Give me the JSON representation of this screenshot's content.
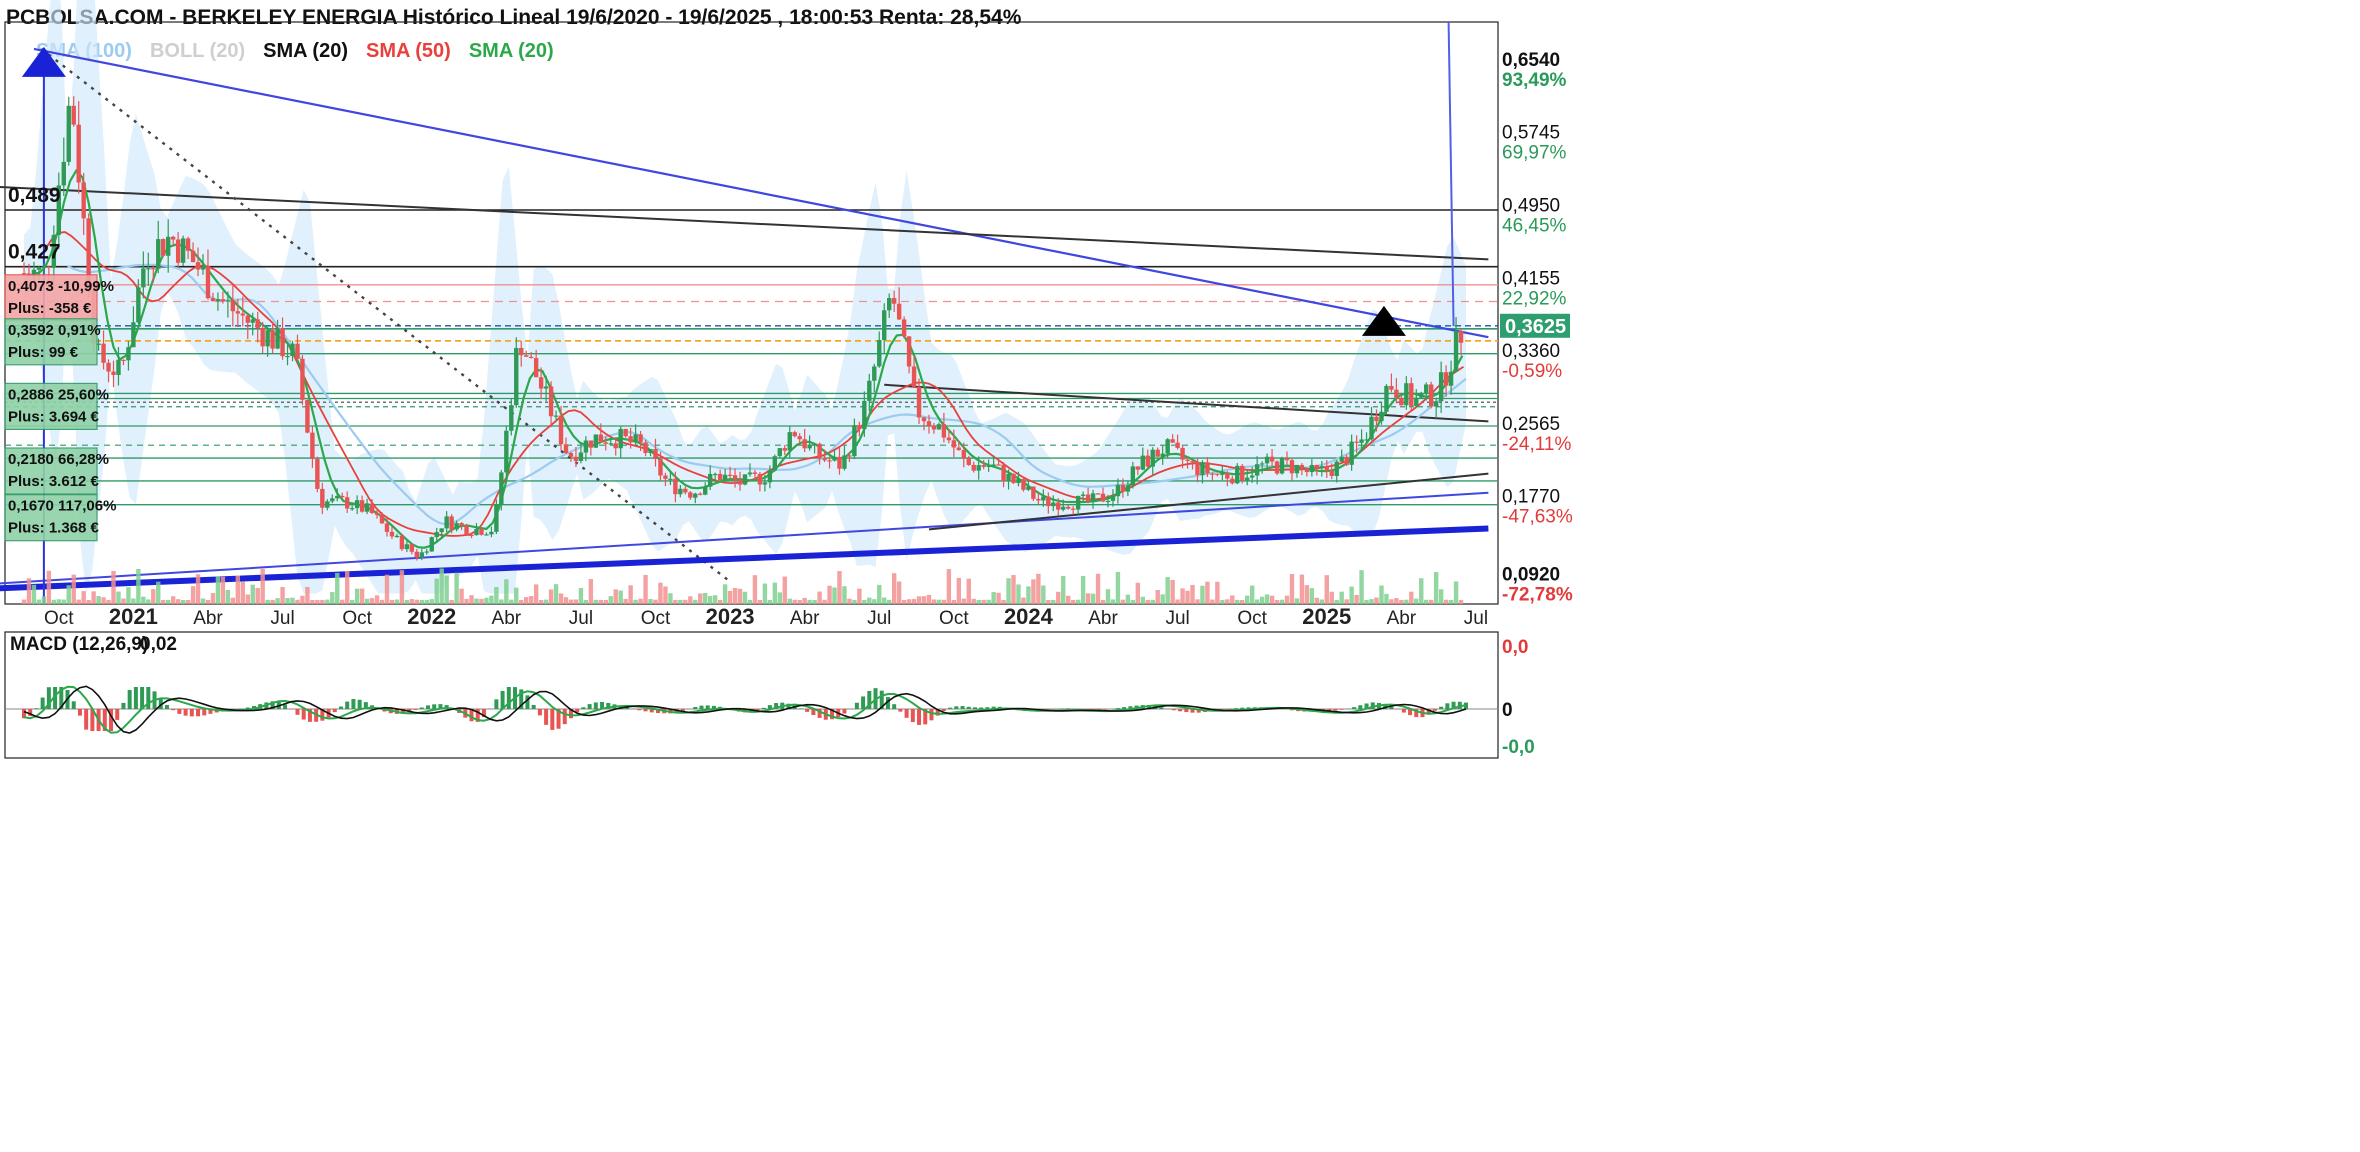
{
  "header": {
    "title": "PCBOLSA.COM - BERKELEY ENERGIA Histórico Lineal 19/6/2020 - 19/6/2025 , 18:00:53 Renta: 28,54%"
  },
  "indicators": [
    {
      "label": "SMA (100)",
      "color": "#9ccbf0"
    },
    {
      "label": "BOLL (20)",
      "color": "#cfcfcf"
    },
    {
      "label": "SMA (20)",
      "color": "#111111"
    },
    {
      "label": "SMA (50)",
      "color": "#e8413b"
    },
    {
      "label": "SMA (20)",
      "color": "#2ca84a"
    }
  ],
  "chart_data": [
    {
      "type": "candlestick",
      "x_ticks": [
        "Oct",
        "2021",
        "Abr",
        "Jul",
        "Oct",
        "2022",
        "Abr",
        "Jul",
        "Oct",
        "2023",
        "Abr",
        "Jul",
        "Oct",
        "2024",
        "Abr",
        "Jul",
        "Oct",
        "2025",
        "Abr",
        "Jul"
      ],
      "ylim": [
        0.0585,
        0.6944
      ],
      "y_axis": [
        {
          "price": "0,6540",
          "pct": "93,49%",
          "sign": "pos"
        },
        {
          "price": "0,5745",
          "pct": "69,97%",
          "sign": "pos"
        },
        {
          "price": "0,4950",
          "pct": "46,45%",
          "sign": "pos"
        },
        {
          "price": "0,4155",
          "pct": "22,92%",
          "sign": "pos"
        },
        {
          "price": "0,3360",
          "pct": "-0,59%",
          "sign": "neg"
        },
        {
          "price": "0,2565",
          "pct": "-24,11%",
          "sign": "neg"
        },
        {
          "price": "0,1770",
          "pct": "-47,63%",
          "sign": "neg"
        },
        {
          "price": "0,0920",
          "pct": "-72,78%",
          "sign": "neg"
        }
      ],
      "current_price": "0,3625",
      "level_labels": [
        "0,489",
        "0,427"
      ],
      "position_boxes": [
        {
          "line1": "0,4073  -10,99%",
          "line2": "Plus: -358 €",
          "style": "loss"
        },
        {
          "line1": "0,3592  0,91%",
          "line2": "Plus: 99 €",
          "style": "gain"
        },
        {
          "line1": "0,2886  25,60%",
          "line2": "Plus: 3.694 €",
          "style": "gain"
        },
        {
          "line1": "0,2180  66,28%",
          "line2": "Plus: 3.612 €",
          "style": "gain"
        },
        {
          "line1": "0,1670  117,06%",
          "line2": "Plus: 1.368 €",
          "style": "gain"
        }
      ],
      "close_series": [
        [
          "2020-09",
          0.42
        ],
        [
          "2020-10",
          0.62
        ],
        [
          "2020-11",
          0.33
        ],
        [
          "2020-12",
          0.31
        ],
        [
          "2021-01",
          0.44
        ],
        [
          "2021-02",
          0.46
        ],
        [
          "2021-03",
          0.43
        ],
        [
          "2021-04",
          0.39
        ],
        [
          "2021-05",
          0.37
        ],
        [
          "2021-06",
          0.35
        ],
        [
          "2021-07",
          0.33
        ],
        [
          "2021-08",
          0.17
        ],
        [
          "2021-09",
          0.17
        ],
        [
          "2021-10",
          0.16
        ],
        [
          "2021-11",
          0.13
        ],
        [
          "2021-12",
          0.11
        ],
        [
          "2022-01",
          0.15
        ],
        [
          "2022-02",
          0.14
        ],
        [
          "2022-03",
          0.14
        ],
        [
          "2022-04",
          0.35
        ],
        [
          "2022-05",
          0.29
        ],
        [
          "2022-06",
          0.22
        ],
        [
          "2022-07",
          0.24
        ],
        [
          "2022-08",
          0.24
        ],
        [
          "2022-09",
          0.23
        ],
        [
          "2022-10",
          0.19
        ],
        [
          "2022-11",
          0.18
        ],
        [
          "2022-12",
          0.2
        ],
        [
          "2023-01",
          0.19
        ],
        [
          "2023-02",
          0.2
        ],
        [
          "2023-03",
          0.25
        ],
        [
          "2023-04",
          0.22
        ],
        [
          "2023-05",
          0.21
        ],
        [
          "2023-06",
          0.28
        ],
        [
          "2023-07",
          0.4
        ],
        [
          "2023-08",
          0.27
        ],
        [
          "2023-09",
          0.25
        ],
        [
          "2023-10",
          0.21
        ],
        [
          "2023-11",
          0.21
        ],
        [
          "2023-12",
          0.19
        ],
        [
          "2024-01",
          0.17
        ],
        [
          "2024-02",
          0.17
        ],
        [
          "2024-03",
          0.17
        ],
        [
          "2024-04",
          0.18
        ],
        [
          "2024-05",
          0.21
        ],
        [
          "2024-06",
          0.23
        ],
        [
          "2024-07",
          0.21
        ],
        [
          "2024-08",
          0.2
        ],
        [
          "2024-09",
          0.2
        ],
        [
          "2024-10",
          0.21
        ],
        [
          "2024-11",
          0.21
        ],
        [
          "2024-12",
          0.2
        ],
        [
          "2025-01",
          0.21
        ],
        [
          "2025-02",
          0.24
        ],
        [
          "2025-03",
          0.3
        ],
        [
          "2025-04",
          0.28
        ],
        [
          "2025-05",
          0.29
        ],
        [
          "2025-06",
          0.3625
        ]
      ]
    },
    {
      "type": "bar",
      "title": "MACD (12,26,9)",
      "current_value": "0,02",
      "y_axis": [
        {
          "label": "0,0",
          "sign": "pos"
        },
        {
          "label": "0",
          "sign": "zero"
        },
        {
          "label": "-0,0",
          "sign": "neg"
        }
      ]
    }
  ]
}
